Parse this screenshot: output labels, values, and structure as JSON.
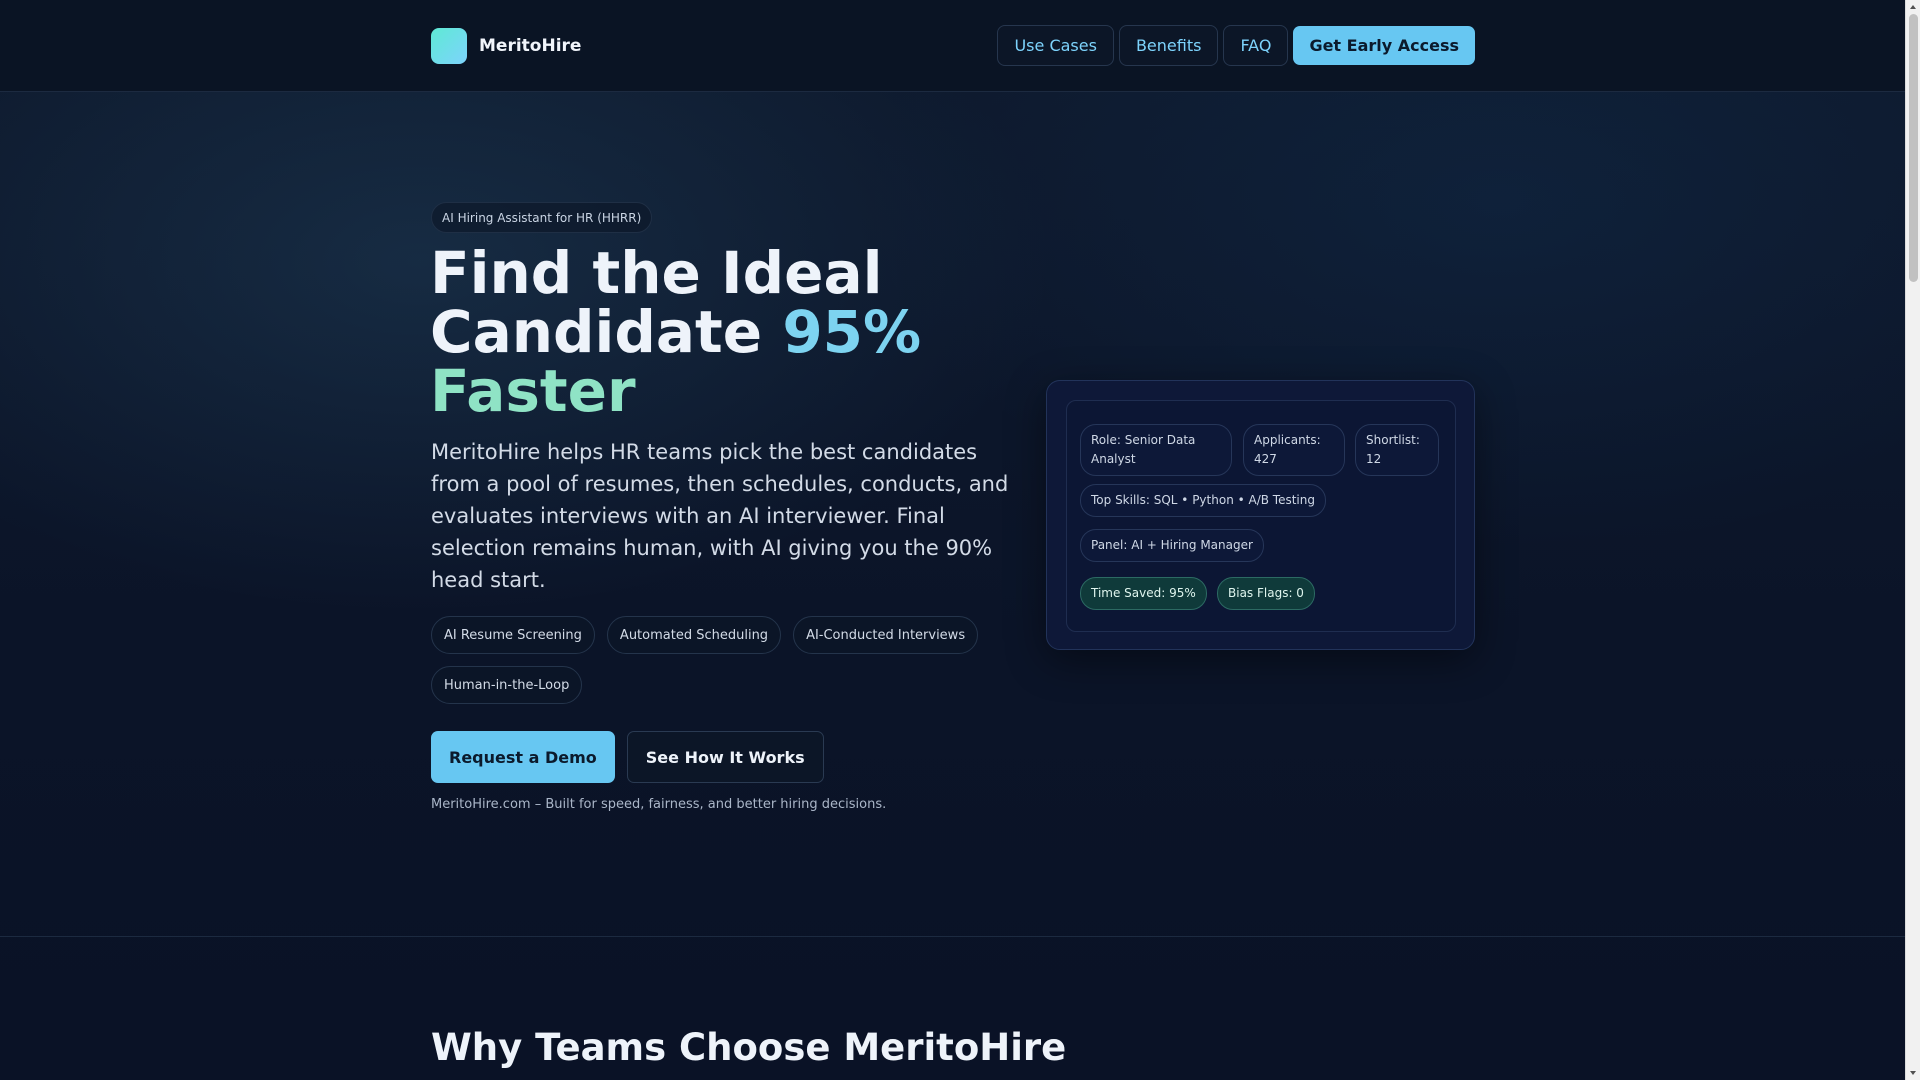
{
  "header": {
    "brand": "MeritoHire",
    "nav": {
      "use_cases": "Use Cases",
      "benefits": "Benefits",
      "faq": "FAQ",
      "cta": "Get Early Access"
    }
  },
  "hero": {
    "eyebrow": "AI Hiring Assistant for HR (HHRR)",
    "title_line1": "Find the Ideal",
    "title_line2_plain": "Candidate ",
    "title_line2_accent": "95%",
    "title_line3_accent": "Faster",
    "description": "MeritoHire helps HR teams pick the best candidates from a pool of resumes, then schedules, conducts, and evaluates interviews with an AI interviewer. Final selection remains human, with AI giving you the 90% head start.",
    "chips": [
      "AI Resume Screening",
      "Automated Scheduling",
      "AI-Conducted Interviews",
      "Human-in-the-Loop"
    ],
    "primary_cta": "Request a Demo",
    "secondary_cta": "See How It Works",
    "tagline": "MeritoHire.com – Built for speed, fairness, and better hiring decisions."
  },
  "card": {
    "role": "Role: Senior Data Analyst",
    "applicants": "Applicants: 427",
    "shortlist": "Shortlist: 12",
    "top_skills": "Top Skills: SQL • Python • A/B Testing",
    "panel": "Panel: AI + Hiring Manager",
    "time_saved": "Time Saved: 95%",
    "bias_flags": "Bias Flags: 0"
  },
  "why": {
    "title": "Why Teams Choose MeritoHire"
  },
  "colors": {
    "accent_blue": "#67c7f2",
    "accent_teal": "#8fe3c5",
    "background": "#0b1226"
  }
}
